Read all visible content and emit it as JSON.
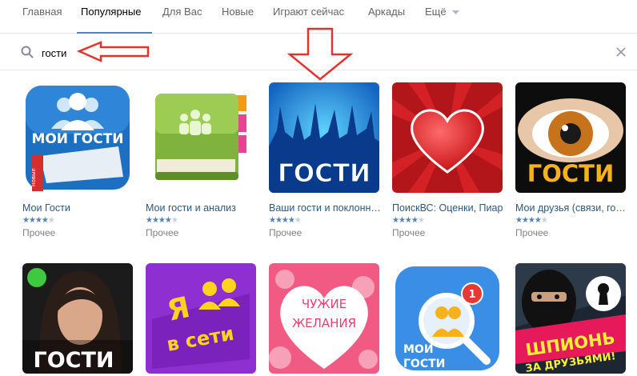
{
  "tabs": [
    {
      "label": "Главная"
    },
    {
      "label": "Популярные"
    },
    {
      "label": "Для Вас"
    },
    {
      "label": "Новые"
    },
    {
      "label": "Играют сейчас"
    },
    {
      "label": "Аркады"
    },
    {
      "label": "Ещё"
    }
  ],
  "active_tab": "Популярные",
  "search": {
    "value": "гости",
    "icon": "search-icon",
    "clear_icon": "close-icon"
  },
  "colors": {
    "accent": "#5181b8",
    "link": "#2a5885",
    "arrow": "#e5322d"
  },
  "apps": [
    {
      "title": "Мои Гости",
      "rating": 4,
      "category": "Прочее",
      "image_text": [
        "МОИ ГОСТИ",
        "новые"
      ]
    },
    {
      "title": "Мои гости и анализ",
      "rating": 4,
      "category": "Прочее",
      "image_text": []
    },
    {
      "title": "Ваши гости и поклонники",
      "rating": 4,
      "category": "Прочее",
      "image_text": [
        "ГОСТИ"
      ]
    },
    {
      "title": "ПоискВС: Оценки, Пиар",
      "rating": 4,
      "category": "Прочее",
      "image_text": []
    },
    {
      "title": "Мои друзья (связи, гости)",
      "rating": 4,
      "category": "Прочее",
      "image_text": [
        "ГОСТИ"
      ]
    },
    {
      "title": "",
      "rating": null,
      "category": "",
      "image_text": [
        "ГОСТИ"
      ]
    },
    {
      "title": "",
      "rating": null,
      "category": "",
      "image_text": [
        "Я",
        "в сети"
      ]
    },
    {
      "title": "",
      "rating": null,
      "category": "",
      "image_text": [
        "ЧУЖИЕ",
        "ЖЕЛАНИЯ"
      ]
    },
    {
      "title": "",
      "rating": null,
      "category": "",
      "image_text": [
        "МОИ",
        "ГОСТИ",
        "1"
      ]
    },
    {
      "title": "",
      "rating": null,
      "category": "",
      "image_text": [
        "ШПИОНЬ",
        "ЗА ДРУЗЬЯМИ!"
      ]
    }
  ]
}
